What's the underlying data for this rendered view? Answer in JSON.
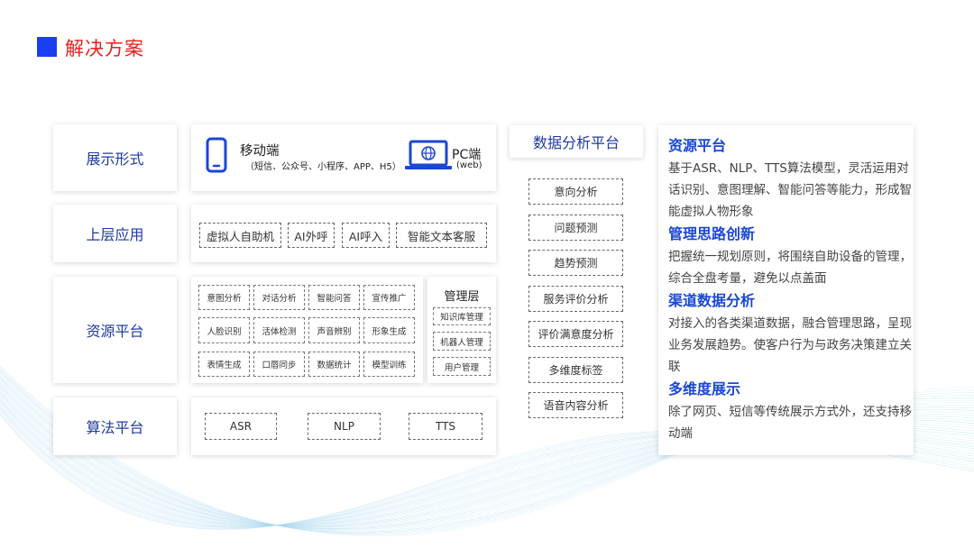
{
  "title": "解决方案",
  "rows": {
    "display": "展示形式",
    "upper": "上层应用",
    "resource": "资源平台",
    "algorithm": "算法平台"
  },
  "display": {
    "mobile_title": "移动端",
    "mobile_sub": "（短信、公众号、小程序、APP、H5）",
    "pc_title": "PC端",
    "pc_sub": "(web)"
  },
  "upper_apps": [
    "虚拟人自助机",
    "AI外呼",
    "AI呼入",
    "智能文本客服"
  ],
  "resource_grid": [
    [
      "意图分析",
      "对话分析",
      "智能问答",
      "宣传推广"
    ],
    [
      "人脸识别",
      "活体检测",
      "声音辨别",
      "形象生成"
    ],
    [
      "表情生成",
      "口唇同步",
      "数据统计",
      "模型训练"
    ]
  ],
  "management": {
    "title": "管理层",
    "items": [
      "知识库管理",
      "机器人管理",
      "用户管理"
    ]
  },
  "algorithms": [
    "ASR",
    "NLP",
    "TTS"
  ],
  "data_platform": {
    "title": "数据分析平台",
    "items": [
      "意向分析",
      "问题预测",
      "趋势预测",
      "服务评价分析",
      "评价满意度分析",
      "多维度标签",
      "语音内容分析"
    ]
  },
  "right_panel": [
    {
      "heading": "资源平台",
      "body": "基于ASR、NLP、TTS算法模型，灵活运用对话识别、意图理解、智能问答等能力，形成智能虚拟人物形象"
    },
    {
      "heading": "管理思路创新",
      "body": " 把握统一规划原则，将围绕自助设备的管理，综合全盘考量，避免以点盖面"
    },
    {
      "heading": "渠道数据分析",
      "body": " 对接入的各类渠道数据，融合管理思路，呈现业务发展趋势。使客户行为与政务决策建立关联"
    },
    {
      "heading": "多维度展示",
      "body": "除了网页、短信等传统展示方式外，还支持移动端"
    }
  ],
  "colors": {
    "accent": "#1a3ef0",
    "title": "#e8201c",
    "label": "#1f3a9e",
    "heading": "#1a47d6",
    "wave": "#a9d8ee"
  }
}
